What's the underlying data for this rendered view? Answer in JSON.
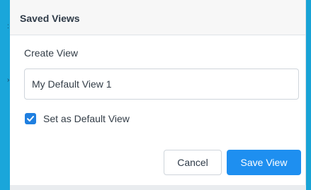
{
  "dialog": {
    "title": "Saved Views",
    "create_label": "Create View",
    "input_value": "My Default View 1",
    "checkbox_label": "Set as Default View",
    "checkbox_checked": true,
    "cancel_label": "Cancel",
    "save_label": "Save View"
  },
  "colors": {
    "background": "#18a3d6",
    "accent": "#1e8ff0",
    "checkbox": "#1f7fe0"
  },
  "icons": {
    "checkbox": "checkmark-icon"
  }
}
